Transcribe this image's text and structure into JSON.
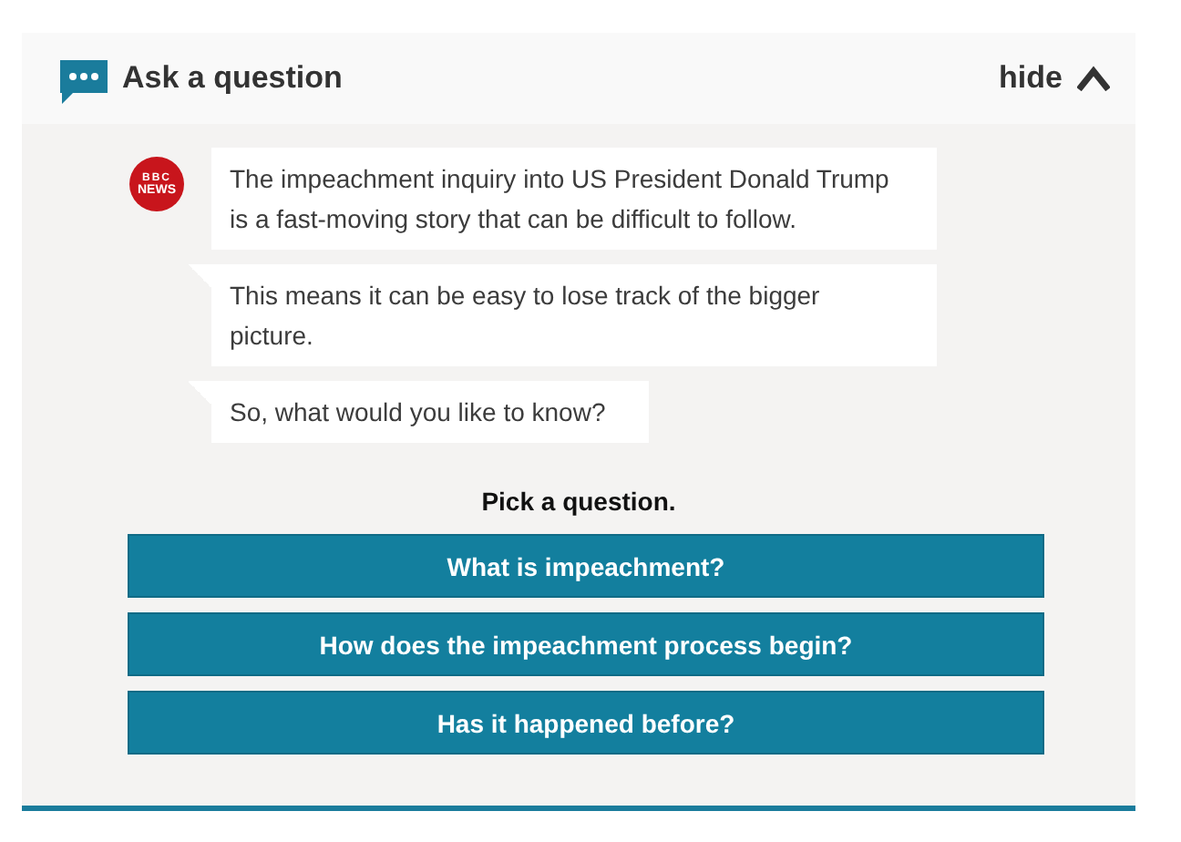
{
  "header": {
    "title": "Ask a question",
    "toggle": "hide"
  },
  "avatar": {
    "line_1": "BBC",
    "line_2": "NEWS"
  },
  "messages": [
    {
      "text": "The impeachment inquiry into US President Donald Trump is a fast-moving story that can be difficult to follow.",
      "tail": false
    },
    {
      "text": "This means it can be easy to lose track of the bigger picture.",
      "tail": true
    },
    {
      "text": "So, what would you like to know?",
      "tail": true
    }
  ],
  "prompt": "Pick a question.",
  "questions": [
    "What is impeachment?",
    "How does the impeachment process begin?",
    "Has it happened before?"
  ]
}
